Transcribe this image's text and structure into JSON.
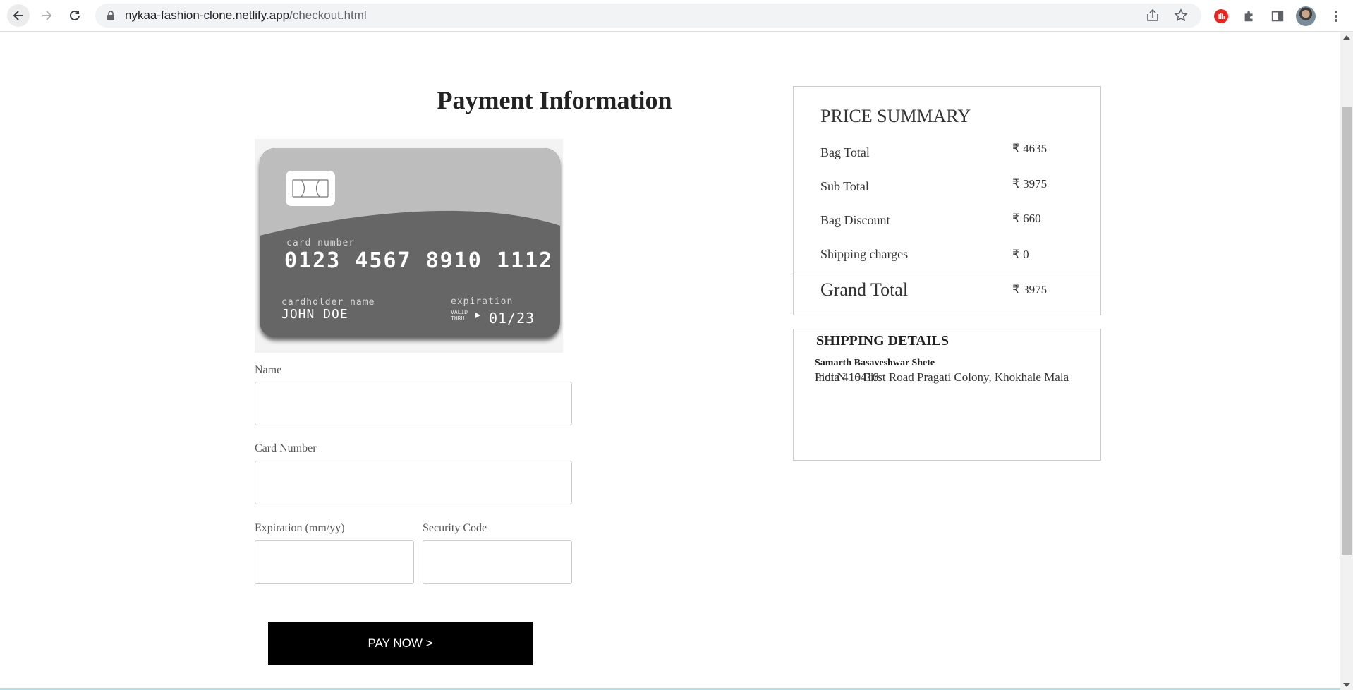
{
  "browser": {
    "url_domain": "nykaa-fashion-clone.netlify.app",
    "url_path": "/checkout.html"
  },
  "payment": {
    "title": "Payment Information",
    "card": {
      "number_label": "card number",
      "number": "0123 4567 8910 1112",
      "holder_label": "cardholder name",
      "holder": "JOHN DOE",
      "expiration_label": "expiration",
      "valid_thru": "VALID THRU",
      "expiration": "01/23"
    },
    "fields": {
      "name_label": "Name",
      "card_number_label": "Card Number",
      "expiration_label": "Expiration (mm/yy)",
      "security_label": "Security Code"
    },
    "pay_button": "PAY NOW >"
  },
  "price_summary": {
    "title": "PRICE SUMMARY",
    "rows": [
      {
        "label": "Bag Total",
        "value": "₹ 4635"
      },
      {
        "label": "Sub Total",
        "value": "₹ 3975"
      },
      {
        "label": "Bag Discount",
        "value": "₹ 660"
      },
      {
        "label": "Shipping charges",
        "value": "₹ 0"
      }
    ],
    "grand_total_label": "Grand Total",
    "grand_total_value": "₹ 3975"
  },
  "shipping": {
    "title": "SHIPPING DETAILS",
    "name": "Samarth Basaveshwar Shete",
    "line_a": "Plot.N 10 First Road Pragati Colony, Khokhale Mala",
    "line_b": "India 416416"
  },
  "colors": {
    "card_light": "#bdbdbd",
    "card_dark": "#666666",
    "button": "#000000",
    "border": "#cccccc"
  }
}
